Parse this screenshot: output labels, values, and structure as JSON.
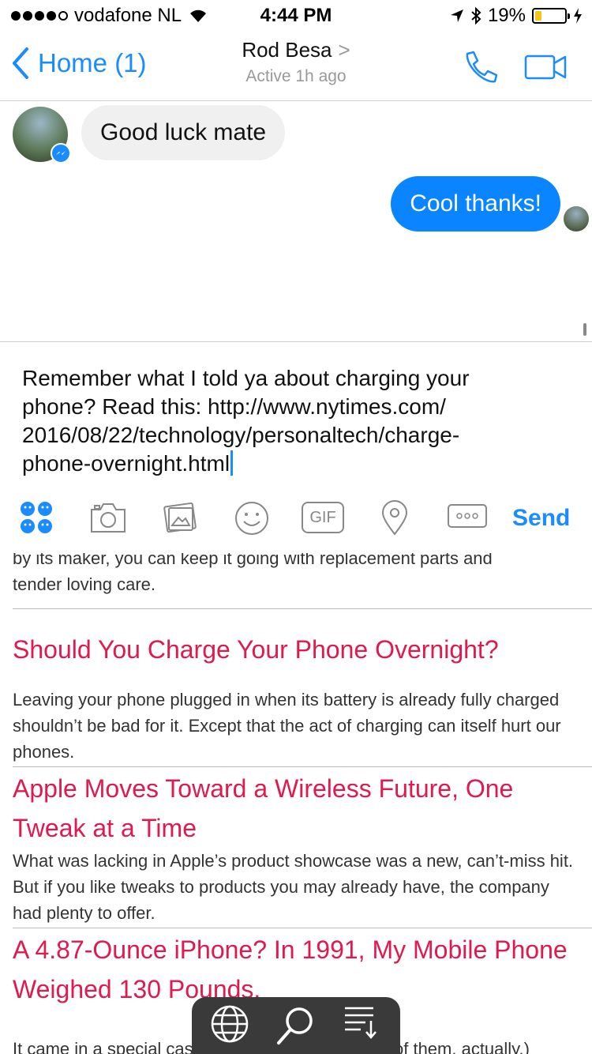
{
  "status_bar": {
    "carrier": "vodafone NL",
    "time": "4:44 PM",
    "battery": "19%",
    "icons": [
      "signal-dots-icon",
      "wifi-icon",
      "location-arrow-icon",
      "bluetooth-icon",
      "battery-icon",
      "charging-bolt-icon"
    ]
  },
  "nav": {
    "back_label": "Home (1)",
    "contact_name": "Rod Besa",
    "contact_status": "Active 1h ago"
  },
  "messages": [
    {
      "from": "them",
      "text": "Good luck mate"
    },
    {
      "from": "me",
      "text": "Cool thanks!"
    }
  ],
  "composer": {
    "draft": "Remember what I told ya about charging your\nphone? Read this: http://www.nytimes.com/\n2016/08/22/technology/personaltech/charge-\nphone-overnight.html",
    "send_label": "Send",
    "gif_label": "GIF"
  },
  "article": {
    "intro_cut": "by its maker, you can keep it going with replacement parts and",
    "intro_end": "tender loving care.",
    "items": [
      {
        "title": "Should You Charge Your Phone Overnight?",
        "body": "Leaving your phone plugged in when its battery is already fully charged shouldn’t be bad for it. Except that the act of charging can itself hurt our phones."
      },
      {
        "title": "Apple Moves Toward a Wireless Future, One Tweak at a Time",
        "body": "What was lacking in Apple’s product showcase was a new, can’t-miss hit. But if you like tweaks to products you may already have, the company had plenty to offer."
      },
      {
        "title": "A 4.87-Ounce iPhone? In 1991, My Mobile Phone Weighed 130 Pounds.",
        "body": "It came in a special case, too — a suitcase. (Two of them, actually.)"
      }
    ]
  },
  "colors": {
    "accent": "#1a8cff",
    "outgoing_bubble": "#0a84ff",
    "incoming_bubble": "#f0f0f0",
    "article_headline": "#e0194f"
  }
}
